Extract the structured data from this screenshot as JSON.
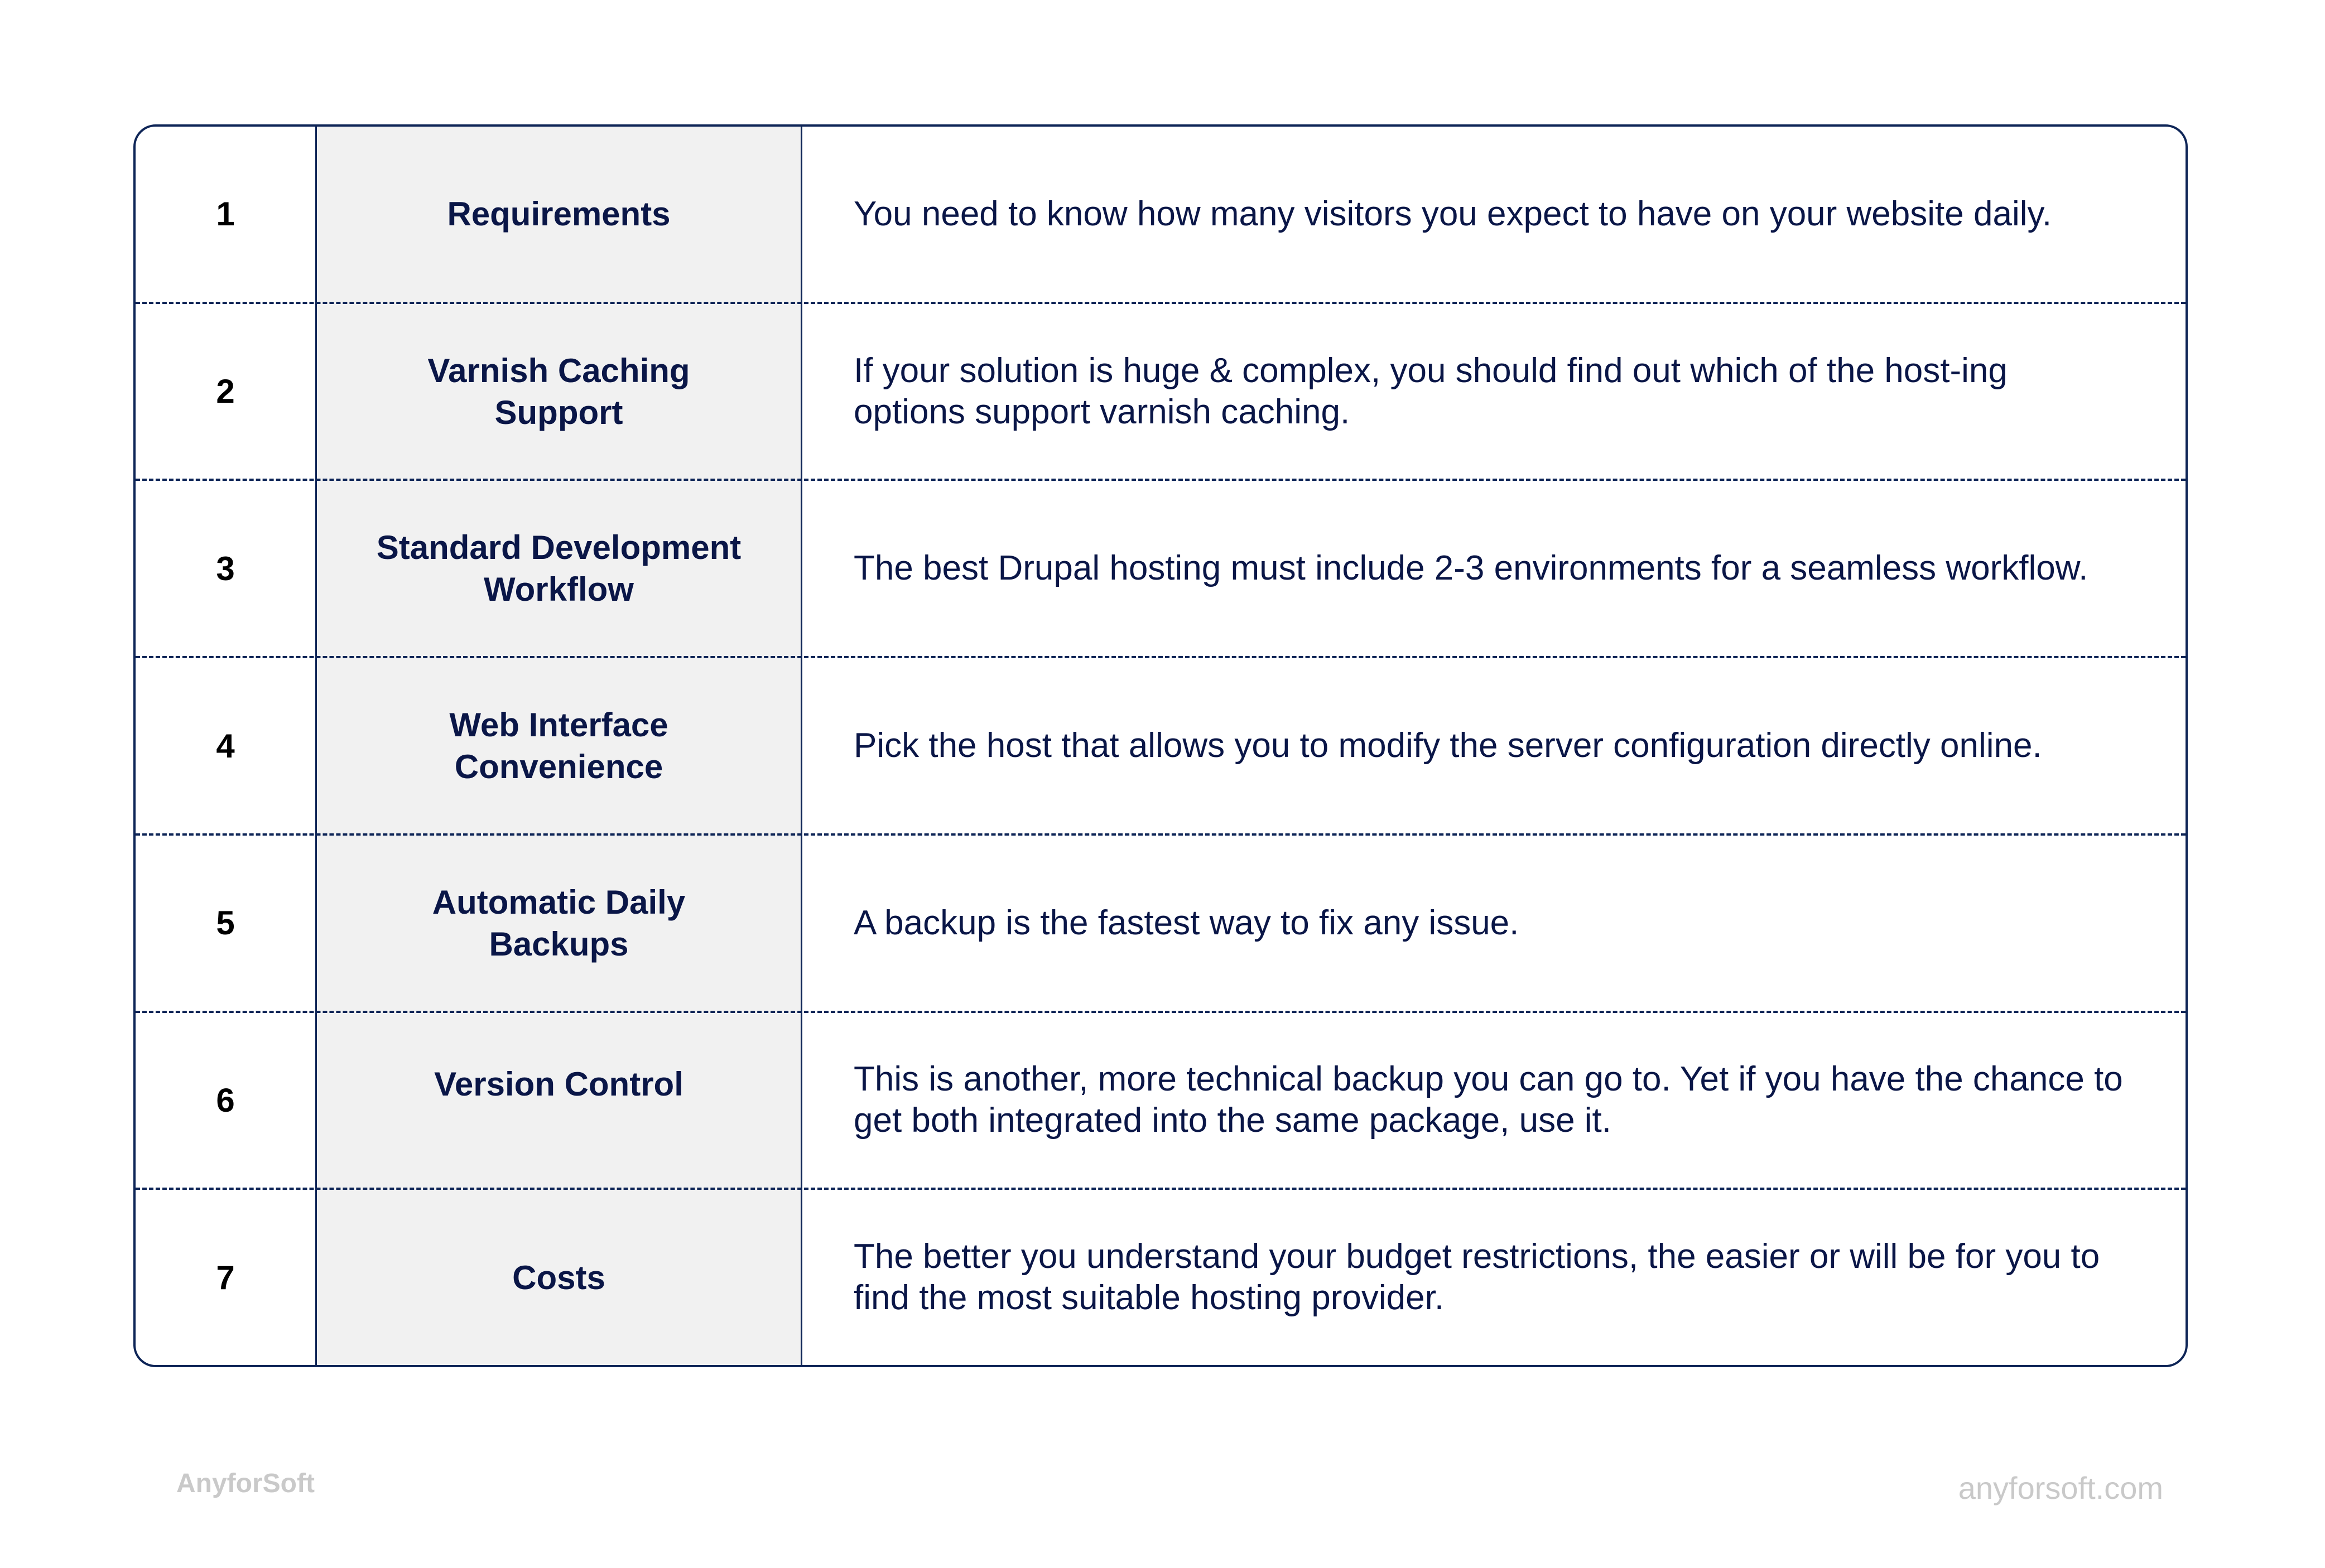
{
  "rows": [
    {
      "number": "1",
      "title": "Requirements",
      "description": "You need to know how many visitors you expect to have on your website daily."
    },
    {
      "number": "2",
      "title": "Varnish Caching Support",
      "description": "If your solution is huge & complex, you should find out which of the host-ing options support varnish caching."
    },
    {
      "number": "3",
      "title": "Standard Development Workflow",
      "description": "The best Drupal hosting must include 2-3 environments for a seamless workflow."
    },
    {
      "number": "4",
      "title": "Web Interface Convenience",
      "description": "Pick the host that allows you to modify the server configuration directly online."
    },
    {
      "number": "5",
      "title": "Automatic Daily Backups",
      "description": "A backup is the fastest way to fix any issue."
    },
    {
      "number": "6",
      "title": "Version Control",
      "description": "This is another, more technical backup you can go to. Yet if you have the chance to get both integrated into the same package, use it."
    },
    {
      "number": "7",
      "title": "Costs",
      "description": "The better you understand your budget restrictions, the easier or will be for you to find the most suitable hosting provider."
    }
  ],
  "footer": {
    "brand": "AnyforSoft",
    "website": "anyforsoft.com"
  },
  "colors": {
    "text": "#0a1647",
    "border": "#0e2557",
    "title_column_bg": "#f1f1f1",
    "footer_text": "#c9c9c9"
  }
}
